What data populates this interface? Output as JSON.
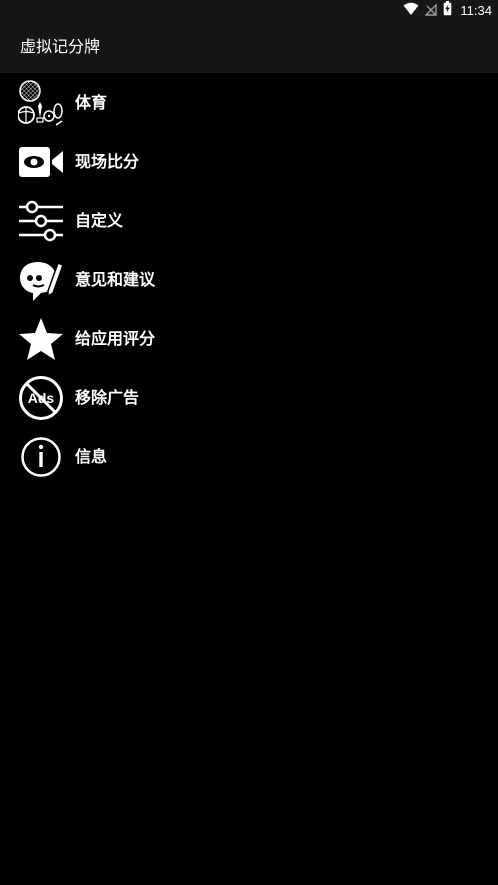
{
  "status_bar": {
    "time": "11:34",
    "icons": [
      "wifi-icon",
      "signal-off-icon",
      "battery-charging-icon"
    ]
  },
  "app_bar": {
    "title": "虚拟记分牌"
  },
  "menu": {
    "items": [
      {
        "label": "体育",
        "icon": "sports-balls-icon"
      },
      {
        "label": "现场比分",
        "icon": "video-camera-icon"
      },
      {
        "label": "自定义",
        "icon": "sliders-icon"
      },
      {
        "label": "意见和建议",
        "icon": "chat-pencil-icon"
      },
      {
        "label": "给应用评分",
        "icon": "star-icon"
      },
      {
        "label": "移除广告",
        "icon": "no-ads-icon"
      },
      {
        "label": "信息",
        "icon": "info-icon"
      }
    ]
  },
  "colors": {
    "background": "#000000",
    "bar": "#161616",
    "text": "#ffffff"
  },
  "icon_text": {
    "ads": "Ads"
  }
}
